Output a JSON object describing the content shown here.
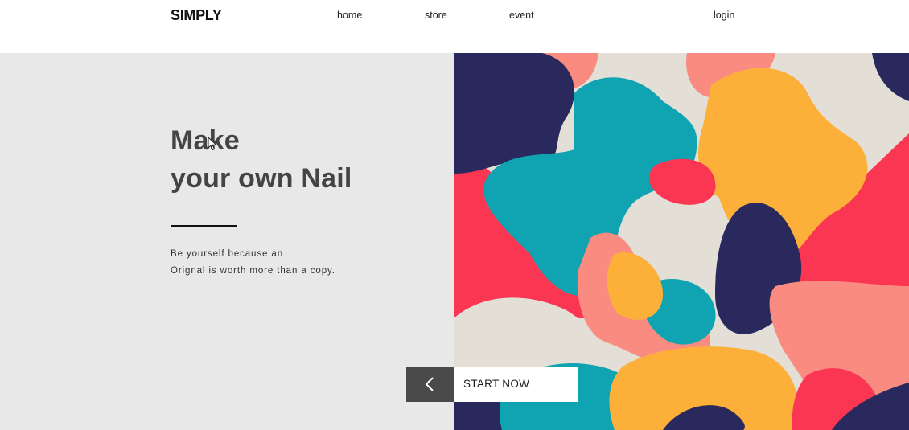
{
  "header": {
    "logo": "SIMPLY",
    "nav": {
      "home": "home",
      "store": "store",
      "event": "event",
      "login": "login"
    }
  },
  "hero": {
    "title_line1": "Make",
    "title_line2": "your own Nail",
    "subtitle_line1": "Be yourself because an",
    "subtitle_line2": "Orignal is worth more than a copy.",
    "cta_label": "START NOW"
  },
  "icons": {
    "prev": "chevron-left-icon",
    "cursor": "mouse-pointer-icon"
  },
  "colors": {
    "hero_bg": "#e8e8e8",
    "navy": "#29295e",
    "teal": "#10a3b2",
    "coral": "#fa8b80",
    "red": "#fb3653",
    "yellow": "#fcb039",
    "cream": "#e3dfd6",
    "cta_dark": "#4a4a4a"
  }
}
